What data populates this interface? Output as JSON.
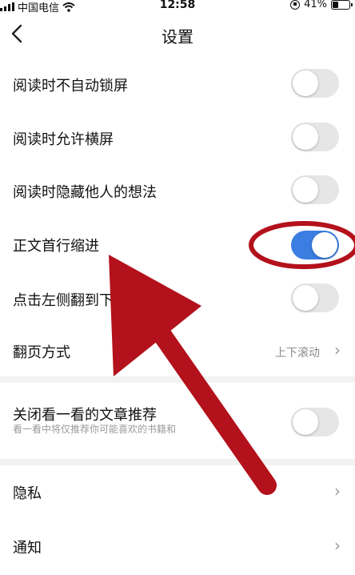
{
  "status_bar": {
    "carrier": "中国电信",
    "time": "12:58",
    "battery": "41%",
    "battery_level": 0.41
  },
  "nav": {
    "title": "设置"
  },
  "settings": {
    "no_auto_lock": {
      "label": "阅读时不自动锁屏",
      "on": false
    },
    "allow_landscape": {
      "label": "阅读时允许横屏",
      "on": false
    },
    "hide_others_thoughts": {
      "label": "阅读时隐藏他人的想法",
      "on": false
    },
    "first_line_indent": {
      "label": "正文首行缩进",
      "on": true
    },
    "tap_left_flip": {
      "label": "点击左侧翻到下一页",
      "on": false
    },
    "page_turn_mode": {
      "label": "翻页方式",
      "value": "上下滚动"
    },
    "close_recommend": {
      "label": "关闭看一看的文章推荐",
      "sublabel": "看一看中将仅推荐你可能喜欢的书籍和",
      "on": false
    },
    "privacy": {
      "label": "隐私"
    },
    "notifications": {
      "label": "通知"
    }
  },
  "colors": {
    "toggle_on": "#3b7de1",
    "toggle_off": "#e6e6e6",
    "annotation": "#b3111b"
  }
}
